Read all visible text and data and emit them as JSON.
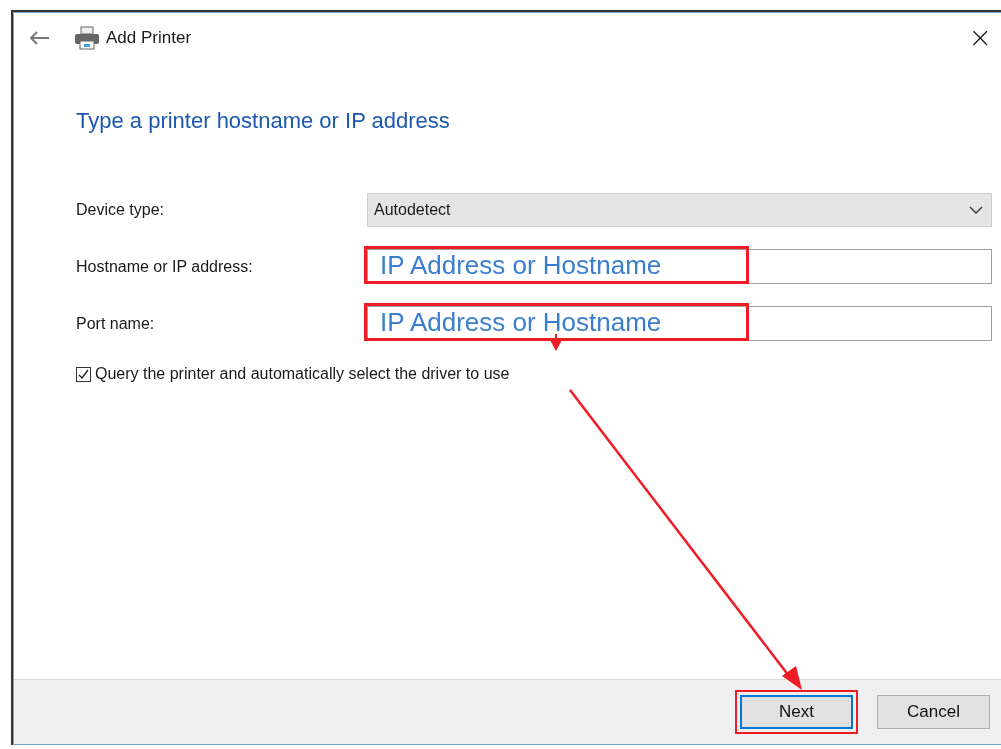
{
  "window": {
    "title": "Add Printer",
    "close": "×"
  },
  "heading": "Type a printer hostname or IP address",
  "form": {
    "rows": [
      {
        "kind": "dropdown",
        "label": "Device type:",
        "value": "Autodetect"
      },
      {
        "kind": "text",
        "label": "Hostname or IP address:",
        "annotation": "IP Address or Hostname"
      },
      {
        "kind": "text",
        "label": "Port name:",
        "annotation": "IP Address or Hostname"
      }
    ],
    "query_checkbox": {
      "label": "Query the printer and automatically select the driver to use",
      "checked": true
    }
  },
  "buttons": [
    {
      "label": "Next",
      "default": true,
      "highlighted": true
    },
    {
      "label": "Cancel",
      "default": false,
      "highlighted": false
    }
  ]
}
